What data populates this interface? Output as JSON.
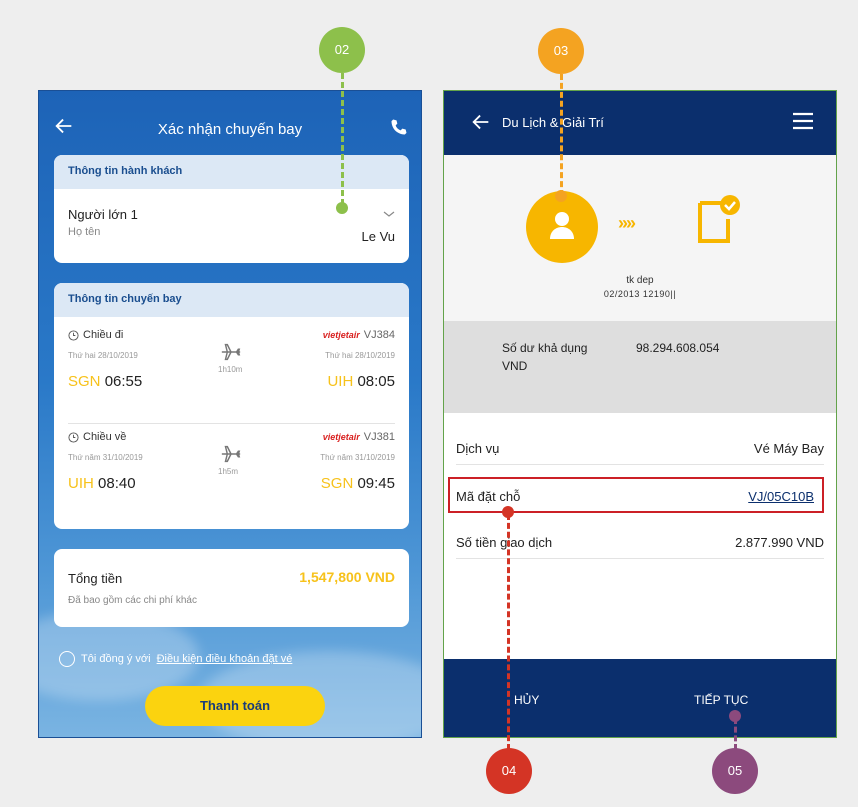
{
  "annotations": {
    "b02": "02",
    "b03": "03",
    "b04": "04",
    "b05": "05"
  },
  "left": {
    "title": "Xác nhận chuyến bay",
    "passenger": {
      "section": "Thông tin hành khách",
      "label": "Người lớn 1",
      "sublabel": "Họ tên",
      "name": "Le Vu"
    },
    "flight": {
      "section": "Thông tin chuyến bay",
      "segments": [
        {
          "direction": "Chiều đi",
          "airline": "VJ384",
          "airline_brand": "vietjetair",
          "date_left": "Thứ hai 28/10/2019",
          "date_right": "Thứ hai 28/10/2019",
          "from_code": "SGN",
          "from_time": "06:55",
          "to_code": "UIH",
          "to_time": "08:05",
          "duration": "1h10m"
        },
        {
          "direction": "Chiều về",
          "airline": "VJ381",
          "airline_brand": "vietjetair",
          "date_left": "Thứ năm 31/10/2019",
          "date_right": "Thứ năm 31/10/2019",
          "from_code": "UIH",
          "from_time": "08:40",
          "to_code": "SGN",
          "to_time": "09:45",
          "duration": "1h5m"
        }
      ]
    },
    "total": {
      "label": "Tổng tiền",
      "value": "1,547,800 VND",
      "note": "Đã bao gồm các chi phí khác"
    },
    "agree_prefix": "Tôi đồng ý với",
    "agree_link": "Điều kiện điều khoản đặt vé",
    "pay_button": "Thanh toán"
  },
  "right": {
    "title": "Du Lịch & Giải Trí",
    "account_name": "tk dep",
    "account_number": "02/2013 12190||",
    "balance_label": "Số dư khả dụng",
    "balance_value": "98.294.608.054",
    "balance_currency": "VND",
    "rows": {
      "service_label": "Dịch vụ",
      "service_value": "Vé Máy Bay",
      "code_label": "Mã đặt chỗ",
      "code_value": "VJ/05C10B",
      "amount_label": "Số tiền giao dịch",
      "amount_value": "2.877.990 VND"
    },
    "cancel_button": "HỦY",
    "next_button": "TIẾP TỤC"
  },
  "colors": {
    "vietjet_red": "#d9201f",
    "accent_yellow": "#f7c21b",
    "navy": "#0b2f6d",
    "badge_green": "#8dc04b",
    "badge_orange": "#f4a321",
    "badge_red": "#d43425",
    "badge_purple": "#8c4a7d"
  }
}
